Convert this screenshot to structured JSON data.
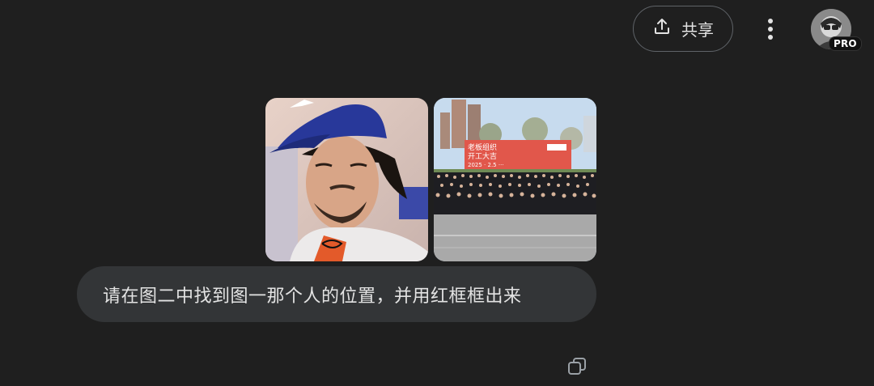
{
  "header": {
    "share_label": "共享",
    "avatar_badge": "PRO"
  },
  "message": {
    "text": "请在图二中找到图一那个人的位置，并用红框框出来",
    "images": [
      {
        "name": "person-photo"
      },
      {
        "name": "group-photo",
        "banner_lines": [
          "老板组织",
          "开工大吉",
          "2025 · 2.5 ···"
        ]
      }
    ]
  },
  "colors": {
    "background": "#1f1f1f",
    "bubble": "#333537",
    "text": "#e3e3e3"
  },
  "icons": [
    "share-icon",
    "more-vert-icon",
    "copy-icon"
  ]
}
